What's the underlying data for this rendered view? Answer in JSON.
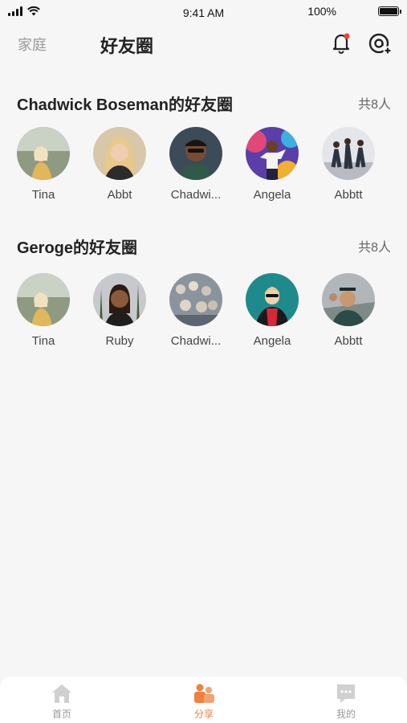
{
  "status_bar": {
    "time": "9:41 AM",
    "battery": "100%"
  },
  "header": {
    "left_label": "家庭",
    "title": "好友圈"
  },
  "sections": [
    {
      "title": "Chadwick Boseman的好友圈",
      "count": "共8人",
      "friends": [
        {
          "name": "Tina"
        },
        {
          "name": "Abbt"
        },
        {
          "name": "Chadwi..."
        },
        {
          "name": "Angela"
        },
        {
          "name": "Abbtt"
        }
      ]
    },
    {
      "title": "Geroge的好友圈",
      "count": "共8人",
      "friends": [
        {
          "name": "Tina"
        },
        {
          "name": "Ruby"
        },
        {
          "name": "Chadwi..."
        },
        {
          "name": "Angela"
        },
        {
          "name": "Abbtt"
        }
      ]
    }
  ],
  "tab_bar": {
    "items": [
      {
        "label": "首页",
        "icon": "home-icon"
      },
      {
        "label": "分享",
        "icon": "people-icon"
      },
      {
        "label": "我的",
        "icon": "chat-icon"
      }
    ],
    "active_color": "#f08040"
  }
}
